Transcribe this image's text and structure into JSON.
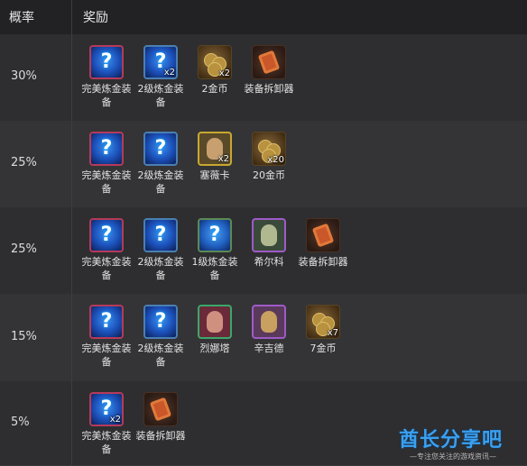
{
  "header": {
    "col_prob": "概率",
    "col_reward": "奖励"
  },
  "rows": [
    {
      "prob": "30%",
      "items": [
        {
          "icon": "perfect-alchemy-equipment-icon",
          "label": "完美炼金装备",
          "count": ""
        },
        {
          "icon": "level2-alchemy-equipment-icon",
          "label": "2级炼金装备",
          "count": "x2"
        },
        {
          "icon": "gold-coin-icon",
          "label": "2金币",
          "count": "x2"
        },
        {
          "icon": "equipment-disassembler-icon",
          "label": "装备拆卸器",
          "count": ""
        }
      ]
    },
    {
      "prob": "25%",
      "items": [
        {
          "icon": "perfect-alchemy-equipment-icon",
          "label": "完美炼金装备",
          "count": ""
        },
        {
          "icon": "level2-alchemy-equipment-icon",
          "label": "2级炼金装备",
          "count": ""
        },
        {
          "icon": "hero-card-icon",
          "label": "塞薇卡",
          "count": "x2"
        },
        {
          "icon": "gold-coin-icon",
          "label": "20金币",
          "count": "x20"
        }
      ]
    },
    {
      "prob": "25%",
      "items": [
        {
          "icon": "perfect-alchemy-equipment-icon",
          "label": "完美炼金装备",
          "count": ""
        },
        {
          "icon": "level2-alchemy-equipment-icon",
          "label": "2级炼金装备",
          "count": ""
        },
        {
          "icon": "level1-alchemy-equipment-icon",
          "label": "1级炼金装备",
          "count": ""
        },
        {
          "icon": "hero-card-icon",
          "label": "希尔科",
          "count": ""
        },
        {
          "icon": "equipment-disassembler-icon",
          "label": "装备拆卸器",
          "count": ""
        }
      ]
    },
    {
      "prob": "15%",
      "items": [
        {
          "icon": "perfect-alchemy-equipment-icon",
          "label": "完美炼金装备",
          "count": ""
        },
        {
          "icon": "level2-alchemy-equipment-icon",
          "label": "2级炼金装备",
          "count": ""
        },
        {
          "icon": "hero-card-icon",
          "label": "烈娜塔",
          "count": ""
        },
        {
          "icon": "hero-card-icon",
          "label": "辛吉德",
          "count": ""
        },
        {
          "icon": "gold-coin-icon",
          "label": "7金币",
          "count": "x7"
        }
      ]
    },
    {
      "prob": "5%",
      "items": [
        {
          "icon": "perfect-alchemy-equipment-icon",
          "label": "完美炼金装备",
          "count": "x2"
        },
        {
          "icon": "equipment-disassembler-icon",
          "label": "装备拆卸器",
          "count": ""
        }
      ]
    }
  ],
  "watermark": {
    "title": "酋长分享吧",
    "subtitle": "—专注您关注的游戏资讯—"
  },
  "colors": {
    "header_bg": "#222224",
    "row_a": "#2e2e30",
    "row_b": "#343436",
    "watermark": "#3aa0f0"
  }
}
